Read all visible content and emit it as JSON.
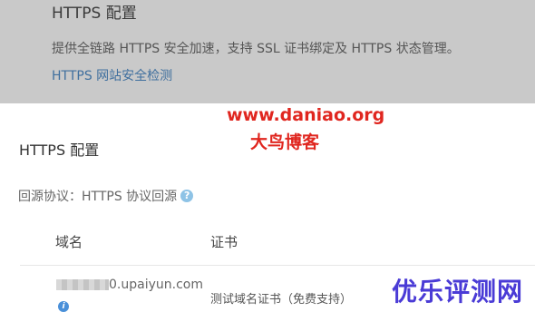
{
  "top": {
    "title": "HTTPS 配置",
    "description": "提供全链路 HTTPS 安全加速，支持 SSL 证书绑定及 HTTPS 状态管理。",
    "check_link": "HTTPS 网站安全检测"
  },
  "main": {
    "section_title": "HTTPS 配置",
    "protocol_label": "回源协议：",
    "protocol_value": "HTTPS 协议回源",
    "help_icon": "?",
    "table": {
      "headers": {
        "domain": "域名",
        "cert": "证书"
      },
      "rows": [
        {
          "domain": "0.upaiyun.com",
          "cert": "测试域名证书（免费支持）",
          "info_icon": "i"
        }
      ]
    }
  },
  "watermark": {
    "url": "www.daniao.org",
    "name": "大鸟博客",
    "brand": "优乐评测网"
  },
  "colors": {
    "link": "#3f6f9e",
    "watermark_red": "#e0261f",
    "watermark_blue": "#4a3bd6",
    "help_icon": "#8ec3e6"
  }
}
